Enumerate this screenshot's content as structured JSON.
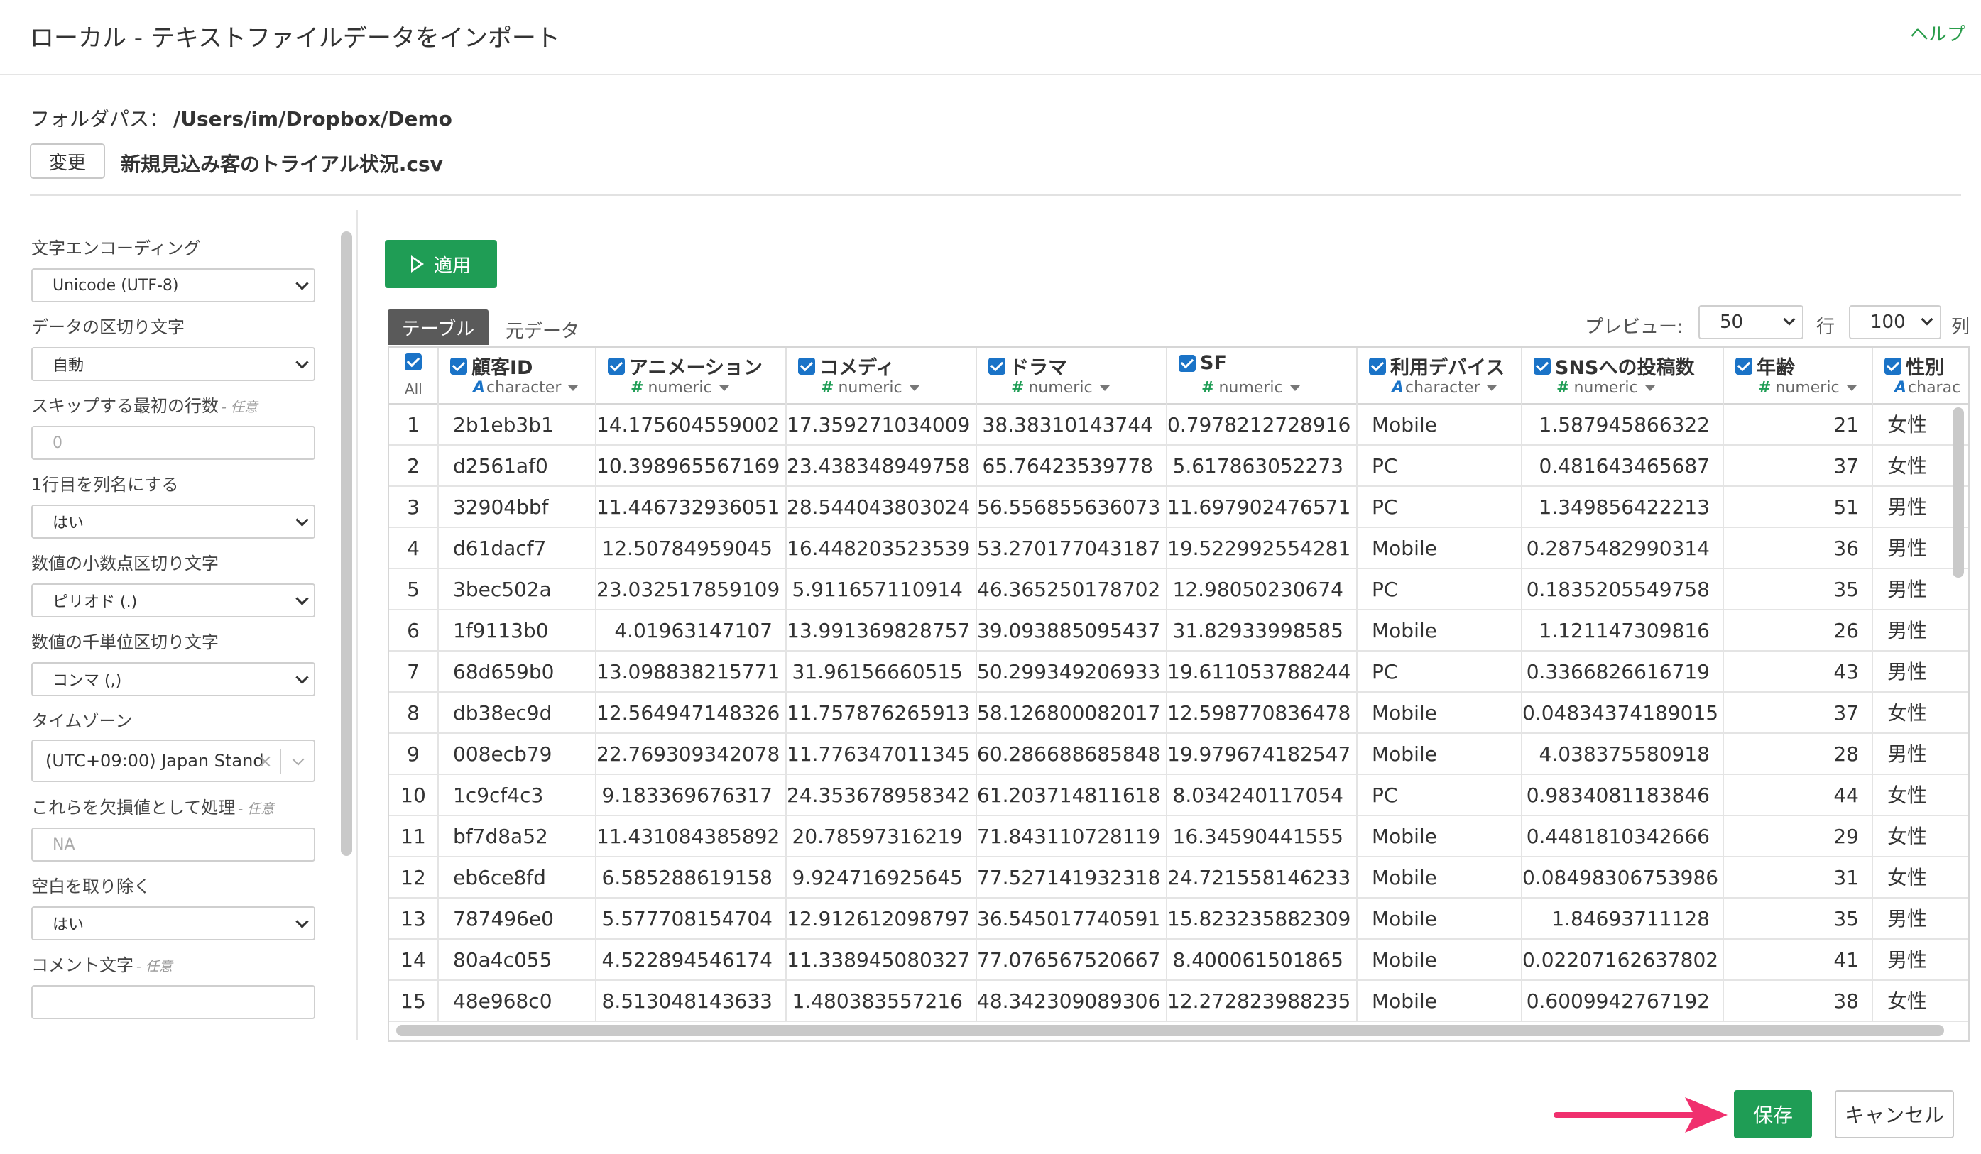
{
  "dialog": {
    "title": "ローカル - テキストファイルデータをインポート",
    "help_label": "ヘルプ",
    "folder_label": "フォルダパス：",
    "folder_path": "/Users/im/Dropbox/Demo",
    "change_label": "変更",
    "file_name": "新規見込み客のトライアル状況.csv"
  },
  "settings": {
    "encoding": {
      "label": "文字エンコーディング",
      "value": "Unicode (UTF-8)"
    },
    "delimiter": {
      "label": "データの区切り文字",
      "value": "自動"
    },
    "skip_rows": {
      "label": "スキップする最初の行数",
      "optional": "- 任意",
      "placeholder": "0"
    },
    "header_row": {
      "label": "1行目を列名にする",
      "value": "はい"
    },
    "decimal_mark": {
      "label": "数値の小数点区切り文字",
      "value": "ピリオド (.)"
    },
    "grouping_mark": {
      "label": "数値の千単位区切り文字",
      "value": "コンマ (,)"
    },
    "timezone": {
      "label": "タイムゾーン",
      "value": "(UTC+09:00) Japan Stand",
      "clear": "×"
    },
    "na_values": {
      "label": "これらを欠損値として処理",
      "optional": "- 任意",
      "placeholder": "NA"
    },
    "trim_ws": {
      "label": "空白を取り除く",
      "value": "はい"
    },
    "comment": {
      "label": "コメント文字",
      "optional": "- 任意",
      "placeholder": ""
    }
  },
  "toolbar": {
    "apply_label": "適用",
    "tab_table": "テーブル",
    "tab_raw": "元データ",
    "preview_label": "プレビュー:",
    "preview_rows": "50",
    "rows_unit": "行",
    "preview_cols": "100",
    "cols_unit": "列"
  },
  "grid": {
    "all_label": "All",
    "columns": [
      {
        "name": "顧客ID",
        "type": "character"
      },
      {
        "name": "アニメーション",
        "type": "numeric"
      },
      {
        "name": "コメディ",
        "type": "numeric"
      },
      {
        "name": "ドラマ",
        "type": "numeric"
      },
      {
        "name": "SF",
        "type": "numeric"
      },
      {
        "name": "利用デバイス",
        "type": "character"
      },
      {
        "name": "SNSへの投稿数",
        "type": "numeric"
      },
      {
        "name": "年齢",
        "type": "numeric"
      },
      {
        "name": "性別",
        "type": "charac"
      }
    ],
    "rows": [
      [
        "1",
        "2b1eb3b1",
        "14.175604559002",
        "17.359271034009",
        "38.38310143744",
        "0.7978212728916",
        "Mobile",
        "1.587945866322",
        "21",
        "女性"
      ],
      [
        "2",
        "d2561af0",
        "10.398965567169",
        "23.438348949758",
        "65.76423539778",
        "5.617863052273",
        "PC",
        "0.481643465687",
        "37",
        "女性"
      ],
      [
        "3",
        "32904bbf",
        "11.446732936051",
        "28.544043803024",
        "56.556855636073",
        "11.697902476571",
        "PC",
        "1.349856422213",
        "51",
        "男性"
      ],
      [
        "4",
        "d61dacf7",
        "12.50784959045",
        "16.448203523539",
        "53.270177043187",
        "19.522992554281",
        "Mobile",
        "0.2875482990314",
        "36",
        "男性"
      ],
      [
        "5",
        "3bec502a",
        "23.032517859109",
        "5.911657110914",
        "46.365250178702",
        "12.98050230674",
        "PC",
        "0.1835205549758",
        "35",
        "男性"
      ],
      [
        "6",
        "1f9113b0",
        "4.01963147107",
        "13.991369828757",
        "39.093885095437",
        "31.82933998585",
        "Mobile",
        "1.121147309816",
        "26",
        "男性"
      ],
      [
        "7",
        "68d659b0",
        "13.098838215771",
        "31.96156660515",
        "50.299349206933",
        "19.611053788244",
        "PC",
        "0.3366826616719",
        "43",
        "男性"
      ],
      [
        "8",
        "db38ec9d",
        "12.564947148326",
        "11.757876265913",
        "58.126800082017",
        "12.598770836478",
        "Mobile",
        "0.04834374189015",
        "37",
        "女性"
      ],
      [
        "9",
        "008ecb79",
        "22.769309342078",
        "11.776347011345",
        "60.286688685848",
        "19.979674182547",
        "Mobile",
        "4.038375580918",
        "28",
        "男性"
      ],
      [
        "10",
        "1c9cf4c3",
        "9.183369676317",
        "24.353678958342",
        "61.203714811618",
        "8.034240117054",
        "PC",
        "0.9834081183846",
        "44",
        "女性"
      ],
      [
        "11",
        "bf7d8a52",
        "11.431084385892",
        "20.78597316219",
        "71.843110728119",
        "16.34590441555",
        "Mobile",
        "0.4481810342666",
        "29",
        "女性"
      ],
      [
        "12",
        "eb6ce8fd",
        "6.585288619158",
        "9.924716925645",
        "77.527141932318",
        "24.721558146233",
        "Mobile",
        "0.08498306753986",
        "31",
        "女性"
      ],
      [
        "13",
        "787496e0",
        "5.577708154704",
        "12.912612098797",
        "36.545017740591",
        "15.823235882309",
        "Mobile",
        "1.84693711128",
        "35",
        "男性"
      ],
      [
        "14",
        "80a4c055",
        "4.522894546174",
        "11.338945080327",
        "77.076567520667",
        "8.400061501865",
        "Mobile",
        "0.02207162637802",
        "41",
        "男性"
      ],
      [
        "15",
        "48e968c0",
        "8.513048143633",
        "1.480383557216",
        "48.342309089306",
        "12.272823988235",
        "Mobile",
        "0.6009942767192",
        "38",
        "女性"
      ]
    ]
  },
  "footer": {
    "save_label": "保存",
    "cancel_label": "キャンセル"
  }
}
